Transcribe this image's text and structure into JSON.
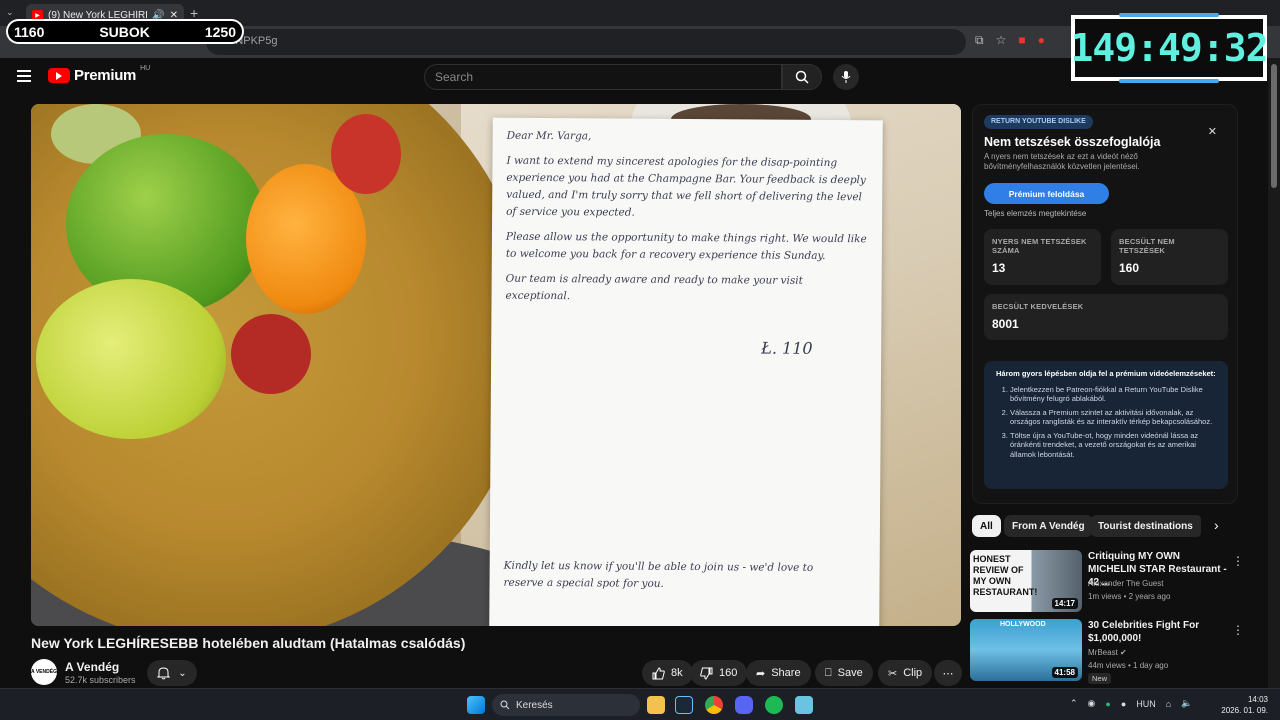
{
  "browser": {
    "tab_title": "(9) New York LEGHÍRESEBB hot",
    "address_fragment": "...3NPKP5g"
  },
  "overlays": {
    "sub_counter": {
      "left": "1160",
      "label": "SUBOK",
      "right": "1250"
    },
    "timer": "149:49:32"
  },
  "header": {
    "brand": "Premium",
    "region": "HU",
    "search_placeholder": "Search"
  },
  "letter": {
    "greeting": "Dear Mr. Varga,",
    "para1": "I want to extend my sincerest apologies for the disap-pointing experience you had at the Champagne Bar. Your feedback is deeply valued, and I'm truly sorry that we fell short of delivering the level of service you expected.",
    "para2": "Please allow us the opportunity to make things right. We would like to welcome you back for a recovery experience this Sunday.",
    "para3": "Our team is already aware and ready to make your visit exceptional.",
    "signature": "Ł. 110",
    "closing": "Kindly let us know if you'll be able to join us - we'd love to reserve a special spot for you."
  },
  "video": {
    "title": "New York LEGHÍRESEBB hotelében aludtam (Hatalmas csalódás)",
    "channel": "A Vendég",
    "channel_avatar_text": "A VENDÉG",
    "subscribers": "52.7k subscribers",
    "likes": "8k",
    "dislikes": "160",
    "share": "Share",
    "save": "Save",
    "clip": "Clip"
  },
  "dislike_panel": {
    "badge": "RETURN YOUTUBE DISLIKE",
    "title": "Nem tetszések összefoglalója",
    "description": "A nyers nem tetszések az ezt a videót néző bővítményfelhasználók közvetlen jelentései.",
    "unlock_button": "Prémium feloldása",
    "full_analysis": "Teljes elemzés megtekintése",
    "raw_label": "NYERS NEM TETSZÉSEK SZÁMA",
    "raw_value": "13",
    "est_dislike_label": "BECSÜLT NEM TETSZÉSEK",
    "est_dislike_value": "160",
    "est_like_label": "BECSÜLT KEDVELÉSEK",
    "est_like_value": "8001",
    "steps_head": "Három gyors lépésben oldja fel a prémium videóelemzéseket:",
    "step1": "Jelentkezzen be Patreon-fiókkal a Return YouTube Dislike bővítmény felugró ablakából.",
    "step2": "Válassza a Premium szintet az aktivitási idővonalak, az országos ranglisták és az interaktív térkép bekapcsolásához.",
    "step3": "Töltse újra a YouTube-ot, hogy minden videónál lássa az óránkénti trendeket, a vezető országokat és az amerikai államok lebontását."
  },
  "chips": [
    "All",
    "From A Vendég",
    "Tourist destinations"
  ],
  "recommendations": [
    {
      "title": "Critiquing MY OWN MICHELIN STAR Restaurant - 42 ...",
      "channel": "Alexander The Guest",
      "meta": "1m views • 2 years ago",
      "duration": "14:17",
      "thumb_text": "HONEST REVIEW OF MY OWN RESTAURANT!"
    },
    {
      "title": "30 Celebrities Fight For $1,000,000!",
      "channel": "MrBeast",
      "meta": "44m views • 1 day ago",
      "duration": "41:58",
      "badge": "New",
      "thumb_text": "HOLLYWOOD"
    }
  ],
  "taskbar": {
    "search": "Keresés",
    "lang": "HUN",
    "time": "14:03",
    "date": "2026. 01. 09."
  },
  "colors": {
    "youtube_red": "#ff0000",
    "accent_blue": "#2f7fe6",
    "timer_cyan": "#5ff0e0"
  }
}
